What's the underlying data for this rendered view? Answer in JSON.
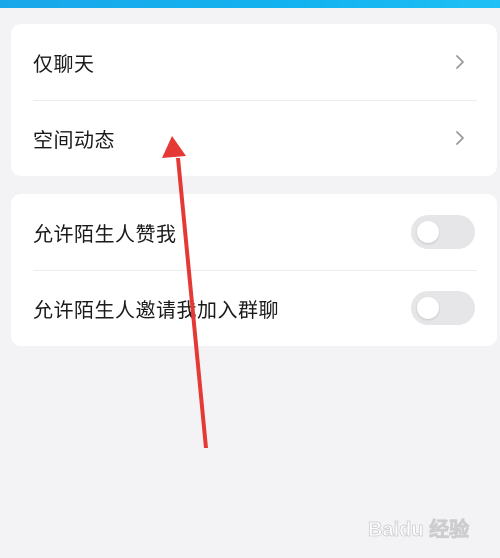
{
  "section_1": {
    "items": [
      {
        "label": "仅聊天",
        "icon": "chevron-right-icon"
      },
      {
        "label": "空间动态",
        "icon": "chevron-right-icon"
      }
    ]
  },
  "section_2": {
    "items": [
      {
        "label": "允许陌生人赞我",
        "enabled": false
      },
      {
        "label": "允许陌生人邀请我加入群聊",
        "enabled": false
      }
    ]
  },
  "annotation": {
    "arrow_color": "#e53935"
  },
  "watermark": {
    "text": "Baidu 经验"
  },
  "colors": {
    "background": "#f3f3f5",
    "card": "#ffffff",
    "toggle_off": "#e6e6e9",
    "accent_top_bar": "#1aa7ea"
  }
}
